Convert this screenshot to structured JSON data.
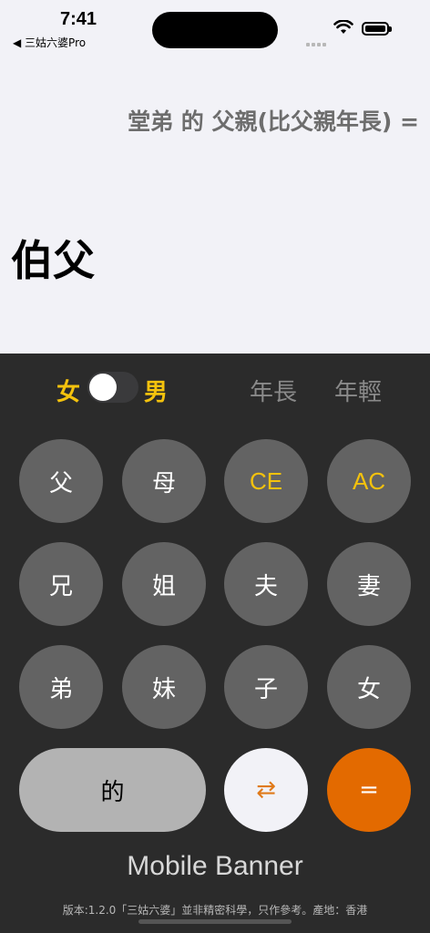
{
  "status": {
    "time": "7:41",
    "back_label": "◀ 三姑六婆Pro"
  },
  "display": {
    "expression": "堂弟 的 父親(比父親年長) =",
    "result": "伯父"
  },
  "toggle": {
    "female": "女",
    "male": "男",
    "older": "年長",
    "younger": "年輕"
  },
  "keys": {
    "father": "父",
    "mother": "母",
    "ce": "CE",
    "ac": "AC",
    "elder_brother": "兄",
    "elder_sister": "姐",
    "husband": "夫",
    "wife": "妻",
    "younger_brother": "弟",
    "younger_sister": "妹",
    "son": "子",
    "daughter": "女",
    "de": "的",
    "swap": "⇄",
    "equals": "="
  },
  "banner": "Mobile Banner",
  "footer": "版本:1.2.0「三姑六婆」並非精密科學，只作參考。產地：香港",
  "colors": {
    "accent": "#f4c20d",
    "equals": "#e36a00",
    "key": "#636363"
  }
}
